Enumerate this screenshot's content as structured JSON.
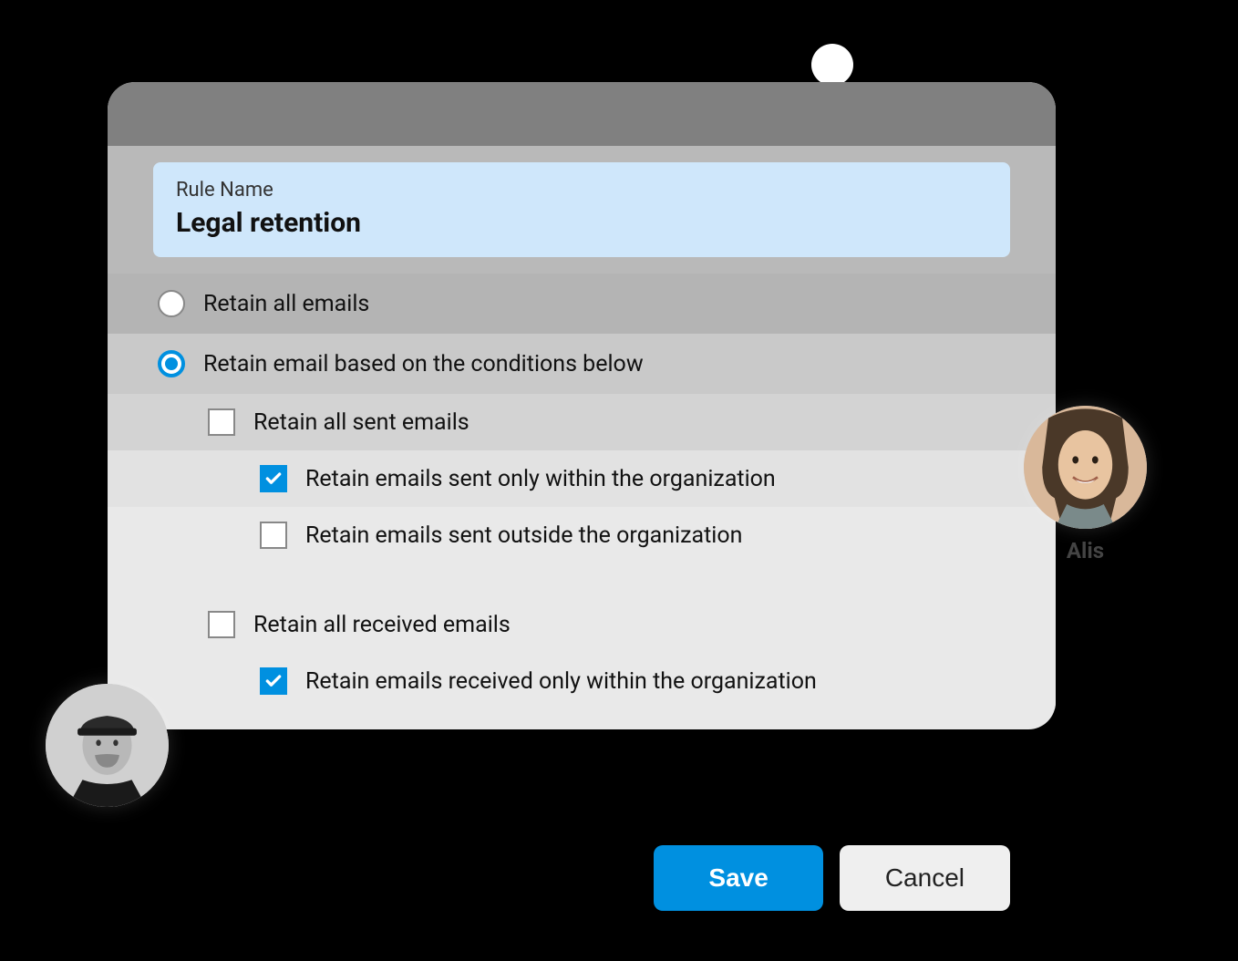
{
  "rule": {
    "label": "Rule Name",
    "value": "Legal retention"
  },
  "radios": {
    "all": {
      "label": "Retain all emails",
      "selected": false
    },
    "conditional": {
      "label": "Retain email based on the conditions below",
      "selected": true
    }
  },
  "checkboxes": {
    "sent_all": {
      "label": "Retain all sent emails",
      "checked": false
    },
    "sent_within": {
      "label": "Retain emails sent only within the organization",
      "checked": true
    },
    "sent_outside": {
      "label": "Retain emails sent outside the organization",
      "checked": false
    },
    "recv_all": {
      "label": "Retain all received emails",
      "checked": false
    },
    "recv_within": {
      "label": "Retain emails received only within the organization",
      "checked": true
    }
  },
  "buttons": {
    "save": "Save",
    "cancel": "Cancel"
  },
  "avatars": {
    "right": {
      "name": "Alis"
    },
    "left": {
      "name": ""
    }
  }
}
